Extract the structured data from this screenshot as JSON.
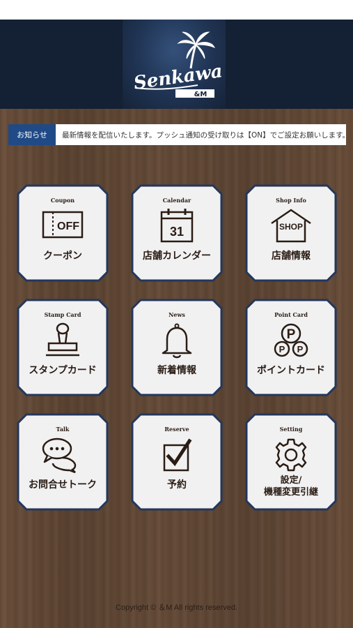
{
  "header": {
    "logo_text": "Senkawa",
    "logo_sub": "&M"
  },
  "news": {
    "label": "お知らせ",
    "text": "最新情報を配信いたします。プッシュ通知の受け取りは【ON】でご設定お願いします。"
  },
  "menu": [
    {
      "en": "Coupon",
      "jp": "クーポン",
      "icon": "coupon-off-icon",
      "icon_text": "OFF"
    },
    {
      "en": "Calendar",
      "jp": "店舗カレンダー",
      "icon": "calendar-icon",
      "icon_text": "31"
    },
    {
      "en": "Shop Info",
      "jp": "店舗情報",
      "icon": "shop-icon",
      "icon_text": "SHOP"
    },
    {
      "en": "Stamp Card",
      "jp": "スタンプカード",
      "icon": "stamp-icon"
    },
    {
      "en": "News",
      "jp": "新着情報",
      "icon": "bell-icon"
    },
    {
      "en": "Point Card",
      "jp": "ポイントカード",
      "icon": "point-coins-icon",
      "icon_text": "P"
    },
    {
      "en": "Talk",
      "jp": "お問合せトーク",
      "icon": "chat-bubbles-icon"
    },
    {
      "en": "Reserve",
      "jp": "予約",
      "icon": "checkbox-icon"
    },
    {
      "en": "Setting",
      "jp": "設定/\n機種変更引継",
      "icon": "gear-icon"
    }
  ],
  "footer": {
    "copyright": "Copyright © ＆M All rights reserved."
  },
  "colors": {
    "header_bg": "#142033",
    "news_label_bg": "#1f4a86",
    "tile_border": "#23375c",
    "tile_fill": "#f1f1f2",
    "ink": "#2a1c14"
  }
}
